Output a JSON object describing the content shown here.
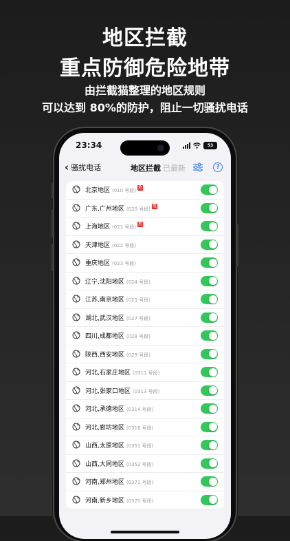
{
  "promo": {
    "title_line1": "地区拦截",
    "title_line2": "重点防御危险地带",
    "subtitle_line1": "由拦截猫整理的地区规则",
    "subtitle_line2": "可以达到 80%的防护，阻止一切骚扰电话"
  },
  "status": {
    "time": "23:34",
    "battery": "53"
  },
  "nav": {
    "back_label": "骚扰电话",
    "title": "地区拦截",
    "latest": "已最新",
    "settings_icon": "sliders-icon",
    "help_icon": "help-icon",
    "help_glyph": "?"
  },
  "colors": {
    "toggle_on": "#34c759",
    "badge": "#e6332a",
    "accent": "#2f7bf6"
  },
  "regions": [
    {
      "name": "北京地区",
      "code": "(010 号段)",
      "badge": "危",
      "enabled": true
    },
    {
      "name": "广东,广州地区",
      "code": "(020 号段)",
      "badge": "危",
      "enabled": true
    },
    {
      "name": "上海地区",
      "code": "(021 号段)",
      "badge": "危",
      "enabled": true
    },
    {
      "name": "天津地区",
      "code": "(022 号段)",
      "badge": "",
      "enabled": true
    },
    {
      "name": "重庆地区",
      "code": "(023 号段)",
      "badge": "",
      "enabled": true
    },
    {
      "name": "辽宁,沈阳地区",
      "code": "(024 号段)",
      "badge": "",
      "enabled": true
    },
    {
      "name": "江苏,南京地区",
      "code": "(025 号段)",
      "badge": "",
      "enabled": true
    },
    {
      "name": "湖北,武汉地区",
      "code": "(027 号段)",
      "badge": "",
      "enabled": true
    },
    {
      "name": "四川,成都地区",
      "code": "(028 号段)",
      "badge": "",
      "enabled": true
    },
    {
      "name": "陕西,西安地区",
      "code": "(029 号段)",
      "badge": "",
      "enabled": true
    },
    {
      "name": "河北,石家庄地区",
      "code": "(0311 号段)",
      "badge": "",
      "enabled": true
    },
    {
      "name": "河北,张家口地区",
      "code": "(0313 号段)",
      "badge": "",
      "enabled": true
    },
    {
      "name": "河北,承德地区",
      "code": "(0314 号段)",
      "badge": "",
      "enabled": true
    },
    {
      "name": "河北,廊坊地区",
      "code": "(0316 号段)",
      "badge": "",
      "enabled": true
    },
    {
      "name": "山西,太原地区",
      "code": "(0351 号段)",
      "badge": "",
      "enabled": true
    },
    {
      "name": "山西,大同地区",
      "code": "(0352 号段)",
      "badge": "",
      "enabled": true
    },
    {
      "name": "河南,郑州地区",
      "code": "(0371 号段)",
      "badge": "",
      "enabled": true
    },
    {
      "name": "河南,新乡地区",
      "code": "(0373 号段)",
      "badge": "",
      "enabled": true
    }
  ]
}
